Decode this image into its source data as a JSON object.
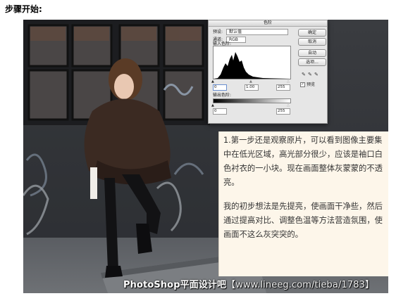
{
  "heading": "步骤开始:",
  "dialog": {
    "title": "色阶",
    "preset_label": "预设:",
    "preset_value": "默认值",
    "channel_label": "通道:",
    "channel_value": "RGB",
    "input_levels_label": "输入色阶:",
    "input_black": "0",
    "input_gamma": "1.00",
    "input_white": "255",
    "output_levels_label": "输出色阶:",
    "output_black": "0",
    "output_white": "255",
    "btn_ok": "确定",
    "btn_cancel": "取消",
    "btn_auto": "自动",
    "btn_options": "选项...",
    "preview_label": "预览"
  },
  "note": {
    "paragraph1": "1.第一步还是观察原片，可以看到图像主要集中在低光区域，高光部分很少，应该是袖口白色衬衣的一小块。现在画面整体灰蒙蒙的不透亮。",
    "paragraph2": "我的初步想法是先提亮，使画面干净些，然后通过提高对比、调整色温等方法营造氛围，使画面不这么灰突突的。"
  },
  "watermark": {
    "brand": "PhotoShop平面设计吧",
    "url": "【www.lineeg.com/tieba/1783】"
  }
}
